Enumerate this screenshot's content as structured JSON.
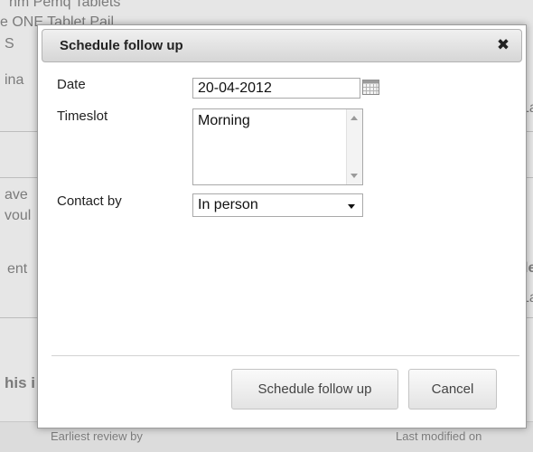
{
  "background": {
    "top_fragments": [
      "nm Pemq Tablets",
      "e ONE Tablet Pail",
      "S",
      "ina"
    ],
    "left_fragments": [
      "ave",
      "voul",
      "ent",
      "his i"
    ],
    "right_fragments": [
      "La",
      "le",
      "La"
    ],
    "footer": {
      "earliest_label": "Earliest review by",
      "modified_label": "Last modified on"
    }
  },
  "modal": {
    "title": "Schedule follow up",
    "close_symbol": "✖",
    "form": {
      "date_label": "Date",
      "date_value": "20-04-2012",
      "timeslot_label": "Timeslot",
      "timeslot_options": [
        "Morning"
      ],
      "contact_label": "Contact by",
      "contact_value": "In person"
    },
    "buttons": {
      "schedule": "Schedule follow up",
      "cancel": "Cancel"
    }
  },
  "icons": {
    "calendar": "calendar-icon",
    "close": "close-icon"
  },
  "colors": {
    "header_gradient_top": "#f0f0f0",
    "header_gradient_bottom": "#d6d6d6"
  }
}
